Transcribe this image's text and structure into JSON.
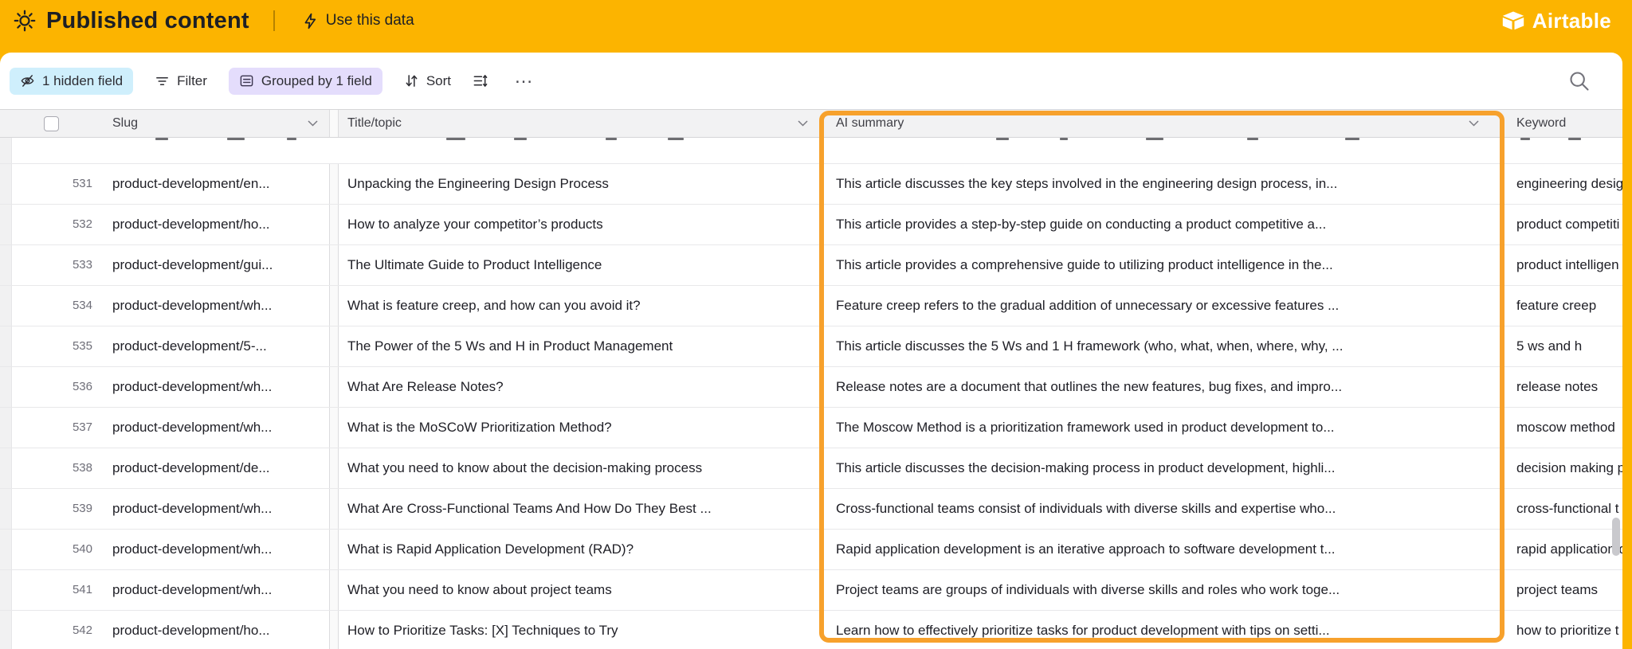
{
  "header": {
    "title": "Published content",
    "use_data_label": "Use this data",
    "brand": "Airtable"
  },
  "toolbar": {
    "hidden_fields_label": "1 hidden field",
    "filter_label": "Filter",
    "grouped_label": "Grouped by 1 field",
    "sort_label": "Sort",
    "more_label": "…"
  },
  "table": {
    "headers": {
      "slug": "Slug",
      "title": "Title/topic",
      "summary": "AI summary",
      "keyword": "Keyword"
    },
    "rows": [
      {
        "num": "531",
        "slug": "product-development/en...",
        "title": "Unpacking the Engineering Design Process",
        "summary": "This article discusses the key steps involved in the engineering design process, in...",
        "keyword": "engineering desig"
      },
      {
        "num": "532",
        "slug": "product-development/ho...",
        "title": "How to analyze your competitor’s products",
        "summary": "This article provides a step-by-step guide on conducting a product competitive a...",
        "keyword": "product competiti"
      },
      {
        "num": "533",
        "slug": "product-development/gui...",
        "title": "The Ultimate Guide to Product Intelligence",
        "summary": "This article provides a comprehensive guide to utilizing product intelligence in the...",
        "keyword": "product intelligen"
      },
      {
        "num": "534",
        "slug": "product-development/wh...",
        "title": "What is feature creep, and how can you avoid it?",
        "summary": "Feature creep refers to the gradual addition of unnecessary or excessive features ...",
        "keyword": "feature creep"
      },
      {
        "num": "535",
        "slug": "product-development/5-...",
        "title": "The Power of the 5 Ws and H in Product Management",
        "summary": "This article discusses the 5 Ws and 1 H framework (who, what, when, where, why, ...",
        "keyword": "5 ws and h"
      },
      {
        "num": "536",
        "slug": "product-development/wh...",
        "title": "What Are Release Notes?",
        "summary": "Release notes are a document that outlines the new features, bug fixes, and impro...",
        "keyword": "release notes"
      },
      {
        "num": "537",
        "slug": "product-development/wh...",
        "title": "What is the MoSCoW Prioritization Method?",
        "summary": "The Moscow Method is a prioritization framework used in product development to...",
        "keyword": "moscow method"
      },
      {
        "num": "538",
        "slug": "product-development/de...",
        "title": "What you need to know about the decision-making process",
        "summary": "This article discusses the decision-making process in product development, highli...",
        "keyword": "decision making p"
      },
      {
        "num": "539",
        "slug": "product-development/wh...",
        "title": "What Are Cross-Functional Teams And How Do They Best ...",
        "summary": "Cross-functional teams consist of individuals with diverse skills and expertise who...",
        "keyword": "cross-functional t"
      },
      {
        "num": "540",
        "slug": "product-development/wh...",
        "title": "What is Rapid Application Development (RAD)?",
        "summary": "Rapid application development is an iterative approach to software development t...",
        "keyword": "rapid application d"
      },
      {
        "num": "541",
        "slug": "product-development/wh...",
        "title": "What you need to know about project teams",
        "summary": "Project teams are groups of individuals with diverse skills and roles who work toge...",
        "keyword": "project teams"
      },
      {
        "num": "542",
        "slug": "product-development/ho...",
        "title": "How to Prioritize Tasks: [X] Techniques to Try",
        "summary": "Learn how to effectively prioritize tasks for product development with tips on setti...",
        "keyword": "how to prioritize t"
      }
    ]
  },
  "colors": {
    "page_yellow": "#FCB400",
    "ai_highlight_orange": "#F7A12C",
    "hidden_pill_bg": "#CFEFFC",
    "grouped_pill_bg": "#E4DDFC"
  }
}
